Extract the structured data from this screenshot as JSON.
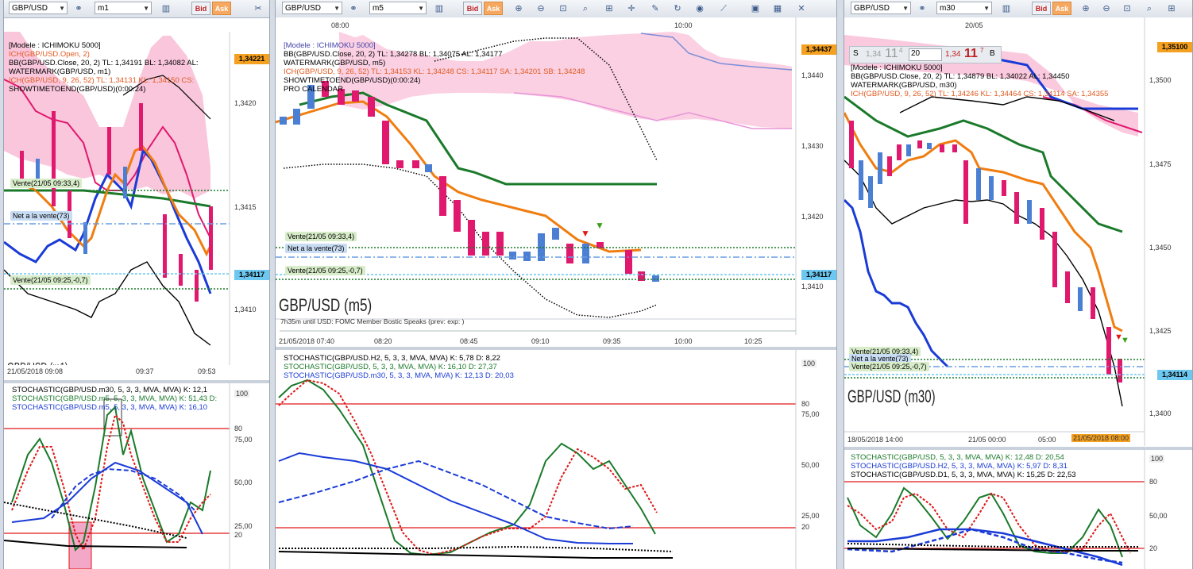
{
  "panels": [
    {
      "symbol": "GBP/USD",
      "timeframe": "m1",
      "bid_label": "Bid",
      "ask_label": "Ask",
      "legend": [
        "[Modele : ICHIMOKU 5000]",
        "ICH(GBP/USD.Open, 2)",
        "BB(GBP/USD.Close, 20, 2)  TL: 1,34191  BL: 1,34082  AL:",
        "WATERMARK(GBP/USD, m1)",
        "ICH(GBP/USD, 9, 26, 52)  TL: 1,34131  KL: 1,34150  CS:",
        "SHOWTIMETOEND(GBP/USD)(0:00:24)"
      ],
      "price_axis": [
        "1,3420",
        "1,3415",
        "1,3410"
      ],
      "price_top": "1,34221",
      "price_current": "1,34117",
      "time_axis": [
        "21/05/2018 09:08",
        "09:37",
        "09:53"
      ],
      "tags": [
        "Vente(21/05 09:33,4)",
        "Net a la vente(73)",
        "Vente(21/05 09:25,-0,7)"
      ],
      "watermark": "GBP/USD (m1)",
      "stoch_legend": [
        "STOCHASTIC(GBP/USD.m30, 5, 3, 3, MVA, MVA)  K: 12,1",
        "STOCHASTIC(GBP/USD.m5, 5, 3, 3, MVA, MVA)  K: 51,43  D:",
        "STOCHASTIC(GBP/USD.m5, 5, 3, 3, MVA, MVA)  K: 16,10"
      ],
      "stoch_axis": [
        "100",
        "80",
        "75,00",
        "50,00",
        "25,00",
        "20"
      ]
    },
    {
      "symbol": "GBP/USD",
      "timeframe": "m5",
      "bid_label": "Bid",
      "ask_label": "Ask",
      "legend": [
        "[Modele : ICHIMOKU 5000]",
        "BB(GBP/USD.Close, 20, 2)  TL: 1,34278  BL: 1,34075  AL: 1,34177",
        "WATERMARK(GBP/USD, m5)",
        "ICH(GBP/USD, 9, 26, 52)  TL: 1,34153  KL: 1,34248  CS: 1,34117  SA: 1,34201  SB: 1,34248",
        "SHOWTIMETOEND(GBP/USD)(0:00:24)",
        "PRO CALENDAR"
      ],
      "price_axis": [
        "1,3440",
        "1,3430",
        "1,3420",
        "1,3410"
      ],
      "price_top": "1,34437",
      "price_current": "1,34117",
      "time_top": [
        "08:00",
        "10:00"
      ],
      "time_axis": [
        "21/05/2018 07:40",
        "08:20",
        "08:45",
        "09:10",
        "09:35",
        "10:00",
        "10:25"
      ],
      "tags": [
        "Vente(21/05 09:33,4)",
        "Net a la vente(73)",
        "Vente(21/05 09:25,-0,7)"
      ],
      "watermark": "GBP/USD (m5)",
      "calendar_note": "7h35m until USD: FOMC Member Bostic Speaks (prev:  exp: )",
      "stoch_legend": [
        "STOCHASTIC(GBP/USD.H2, 5, 3, 3, MVA, MVA)  K: 5,78  D: 8,22",
        "STOCHASTIC(GBP/USD, 5, 3, 3, MVA, MVA)  K: 16,10  D: 27,37",
        "STOCHASTIC(GBP/USD.m30, 5, 3, 3, MVA, MVA)  K: 12,13  D: 20,03"
      ],
      "stoch_axis": [
        "100",
        "80",
        "75,00",
        "50,00",
        "25,00",
        "20"
      ]
    },
    {
      "symbol": "GBP/USD",
      "timeframe": "m30",
      "bid_label": "Bid",
      "ask_label": "Ask",
      "legend": [
        "[Modele : ICHIMOKU 5000]",
        "BB(GBP/USD.Close, 20, 2)  TL: 1,34879  BL: 1,34022  AL: 1,34450",
        "WATERMARK(GBP/USD, m30)",
        "ICH(GBP/USD, 9, 26, 52)  TL: 1,34246  KL: 1,34464  CS: 1,34114  SA: 1,34355"
      ],
      "trade_widget": {
        "sell": "S",
        "sell_price": "1,34",
        "sell_big": "11",
        "sell_sup": "4",
        "qty": "20",
        "buy_price": "1,34",
        "buy_big": "11",
        "buy_sup": "7",
        "buy": "B"
      },
      "price_axis": [
        "1,3500",
        "1,3475",
        "1,3450",
        "1,3425",
        "1,3400"
      ],
      "price_top": "1,35100",
      "price_current": "1,34114",
      "time_top": [
        "20/05"
      ],
      "time_axis": [
        "18/05/2018 14:00",
        "21/05 00:00",
        "05:00",
        "21/05/2018 08:00"
      ],
      "tags": [
        "Vente(21/05 09:33,4)",
        "Net a la vente(73)",
        "Vente(21/05 09:25,-0,7)"
      ],
      "watermark": "GBP/USD (m30)",
      "stoch_legend": [
        "STOCHASTIC(GBP/USD, 5, 3, 3, MVA, MVA)  K: 12,48  D: 20,54",
        "STOCHASTIC(GBP/USD.H2, 5, 3, 3, MVA, MVA)  K: 5,97  D: 8,31",
        "STOCHASTIC(GBP/USD.D1, 5, 3, 3, MVA, MVA)  K: 15,25  D: 22,53"
      ],
      "stoch_axis": [
        "100",
        "80",
        "50,00",
        "20"
      ]
    }
  ],
  "colors": {
    "cloud": "#f9c0d8",
    "bull": "#4a7fd4",
    "bear": "#e0196f",
    "tenkan": "#f07d10",
    "kijun": "#1a7a2a",
    "current": "#6cc8f0",
    "top": "#f4a020",
    "tag_green": "#d7ecc9",
    "tag_blue": "#c8dcf4"
  }
}
